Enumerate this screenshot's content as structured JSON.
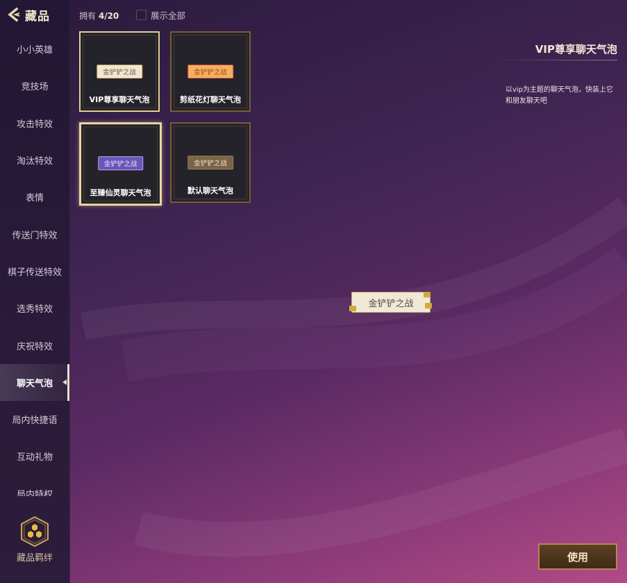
{
  "header": {
    "back_icon": "chevron-left-icon",
    "title": "藏品"
  },
  "collection": {
    "owned_label": "拥有",
    "owned_count": "4/20",
    "show_all_label": "展示全部"
  },
  "sidebar": {
    "items": [
      {
        "label": "小小英雄",
        "active": false
      },
      {
        "label": "竞技场",
        "active": false
      },
      {
        "label": "攻击特效",
        "active": false
      },
      {
        "label": "淘汰特效",
        "active": false
      },
      {
        "label": "表情",
        "active": false
      },
      {
        "label": "传送门特效",
        "active": false
      },
      {
        "label": "棋子传送特效",
        "active": false
      },
      {
        "label": "选秀特效",
        "active": false
      },
      {
        "label": "庆祝特效",
        "active": false
      },
      {
        "label": "聊天气泡",
        "active": true
      },
      {
        "label": "局内快捷语",
        "active": false
      },
      {
        "label": "互动礼物",
        "active": false
      },
      {
        "label": "局内特权",
        "active": false
      }
    ],
    "bond": {
      "icon": "honeycomb-icon",
      "label": "藏品羁绊"
    }
  },
  "cards": [
    {
      "name": "VIP尊享聊天气泡",
      "bubble_text": "金铲铲之战",
      "style": "vip",
      "selected": false
    },
    {
      "name": "剪纸花灯聊天气泡",
      "bubble_text": "金铲铲之战",
      "style": "paper",
      "selected": false
    },
    {
      "name": "至臻仙灵聊天气泡",
      "bubble_text": "金铲铲之战",
      "style": "fairy",
      "selected": true
    },
    {
      "name": "默认聊天气泡",
      "bubble_text": "金铲铲之战",
      "style": "default",
      "selected": false
    }
  ],
  "detail": {
    "title": "VIP尊享聊天气泡",
    "description": "以vip为主题的聊天气泡，快装上它和朋友聊天吧",
    "preview_text": "金铲铲之战"
  },
  "actions": {
    "use_label": "使用"
  },
  "colors": {
    "accent_gold": "#b58a4d",
    "selected_border": "#e9d79e"
  }
}
